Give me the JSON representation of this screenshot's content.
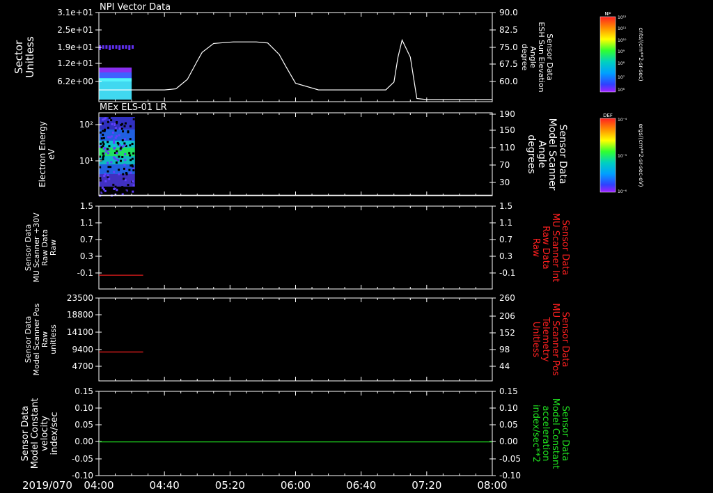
{
  "colors": {
    "background": "#000000",
    "foreground": "#ffffff",
    "red_series": "#ff2020",
    "green_series": "#20e020",
    "red_label": "#ff2020",
    "green_label": "#20e020"
  },
  "x_axis": {
    "date_label": "2019/070",
    "ticks": [
      "04:00",
      "04:40",
      "05:20",
      "06:00",
      "06:40",
      "07:20",
      "08:00"
    ],
    "range_minutes": [
      0,
      240
    ]
  },
  "colorbars": [
    {
      "id": "npi",
      "name": "NF",
      "unit": "cnts/(cm**2-sr-sec)",
      "tick_labels": [
        "10¹²",
        "10¹¹",
        "10¹⁰",
        "10⁹",
        "10⁸",
        "10⁷",
        "10⁶"
      ]
    },
    {
      "id": "els",
      "name": "DEF",
      "unit": "ergs/(cm**2-sr-sec-eV)",
      "tick_labels": [
        "10⁻⁴",
        "10⁻⁵",
        "10⁻⁶"
      ]
    }
  ],
  "chart_data": [
    {
      "type": "heatmap",
      "title": "NPI Vector Data",
      "ylabel_left": [
        "Sector",
        "Unitless"
      ],
      "yticks_left": [
        "3.1e+01",
        "2.5e+01",
        "1.9e+01",
        "1.2e+01",
        "6.2e+00"
      ],
      "ylabel_right": [
        "Sensor Data",
        "ESH Sun Elevation",
        "Angle",
        "degree"
      ],
      "yticks_right": [
        "90.0",
        "82.5",
        "75.0",
        "67.5",
        "60.0"
      ],
      "ylim_right": [
        56.0,
        90.0
      ],
      "heatmap_time_range_minutes": [
        0,
        20
      ],
      "line_series": {
        "name": "ESH Sun Elevation Angle",
        "x_minutes": [
          0,
          40,
          47,
          54,
          60,
          63,
          70,
          82,
          96,
          103,
          110,
          114,
          120,
          134,
          175,
          180,
          182.5,
          185,
          190,
          194,
          200,
          240
        ],
        "y": [
          60.5,
          60.5,
          60.9,
          64.5,
          71.5,
          74.8,
          78.2,
          78.8,
          78.8,
          78.4,
          74.0,
          69.5,
          63.0,
          60.5,
          60.5,
          63.5,
          73.0,
          79.5,
          73.0,
          57.2,
          56.8,
          56.8
        ]
      }
    },
    {
      "type": "heatmap",
      "title": "MEx ELS-01 LR",
      "ylabel_left": [
        "Electron Energy",
        "eV"
      ],
      "yticks_left": [
        "10²",
        "10¹"
      ],
      "ylabel_right": [
        "Sensor Data",
        "Model Scanner",
        "Angle",
        "degrees"
      ],
      "yticks_right": [
        "190",
        "150",
        "110",
        "70",
        "30"
      ],
      "ylim_right": [
        10,
        190
      ],
      "heatmap_time_range_minutes": [
        0,
        22
      ],
      "line_series": {
        "name": "Model Scanner Angle",
        "x_minutes": [
          0,
          240
        ],
        "y": [
          11,
          11
        ]
      }
    },
    {
      "type": "line",
      "ylabel_left": [
        "Sensor Data",
        "MU Scanner +30V",
        "Raw Data",
        "Raw"
      ],
      "yticks_left": [
        "1.5",
        "1.1",
        "0.7",
        "0.3",
        "-0.1"
      ],
      "ylim_left": [
        -0.3,
        1.5
      ],
      "ylabel_right": [
        "Sensor Data",
        "MU Scanner Int",
        "Raw Data",
        "Raw"
      ],
      "yticks_right": [
        "1.5",
        "1.1",
        "0.7",
        "0.3",
        "-0.1"
      ],
      "series": [
        {
          "x_minutes": [
            0,
            27
          ],
          "y": [
            0.0,
            0.0
          ],
          "color": "#ff2020"
        }
      ]
    },
    {
      "type": "line",
      "ylabel_left": [
        "Sensor Data",
        "Model Scanner Pos",
        "Raw",
        "unitless"
      ],
      "yticks_left": [
        "23500",
        "18800",
        "14100",
        "9400",
        "4700"
      ],
      "ylim_left": [
        0,
        23500
      ],
      "ylabel_right": [
        "Sensor Data",
        "MU Scanner Pos",
        "Telemetry",
        "Unitless"
      ],
      "yticks_right": [
        "260",
        "206",
        "152",
        "98",
        "44"
      ],
      "series": [
        {
          "x_minutes": [
            0,
            27
          ],
          "y": [
            8200,
            8200
          ],
          "color": "#ff2020"
        }
      ]
    },
    {
      "type": "line",
      "ylabel_left": [
        "Sensor Data",
        "Model Constant",
        "velocity",
        "index/sec"
      ],
      "yticks_left": [
        "0.15",
        "0.10",
        "0.05",
        "0.00",
        "-0.05",
        "-0.10"
      ],
      "ylim_left": [
        -0.1,
        0.15
      ],
      "ylabel_right": [
        "Sensor Data",
        "Model Constant",
        "acceleration",
        "index/sec**2"
      ],
      "yticks_right": [
        "0.15",
        "0.10",
        "0.05",
        "0.00",
        "-0.05",
        "-0.10"
      ],
      "series": [
        {
          "x_minutes": [
            0,
            240
          ],
          "y": [
            0.0,
            0.0
          ],
          "color": "#20e020"
        }
      ]
    }
  ]
}
